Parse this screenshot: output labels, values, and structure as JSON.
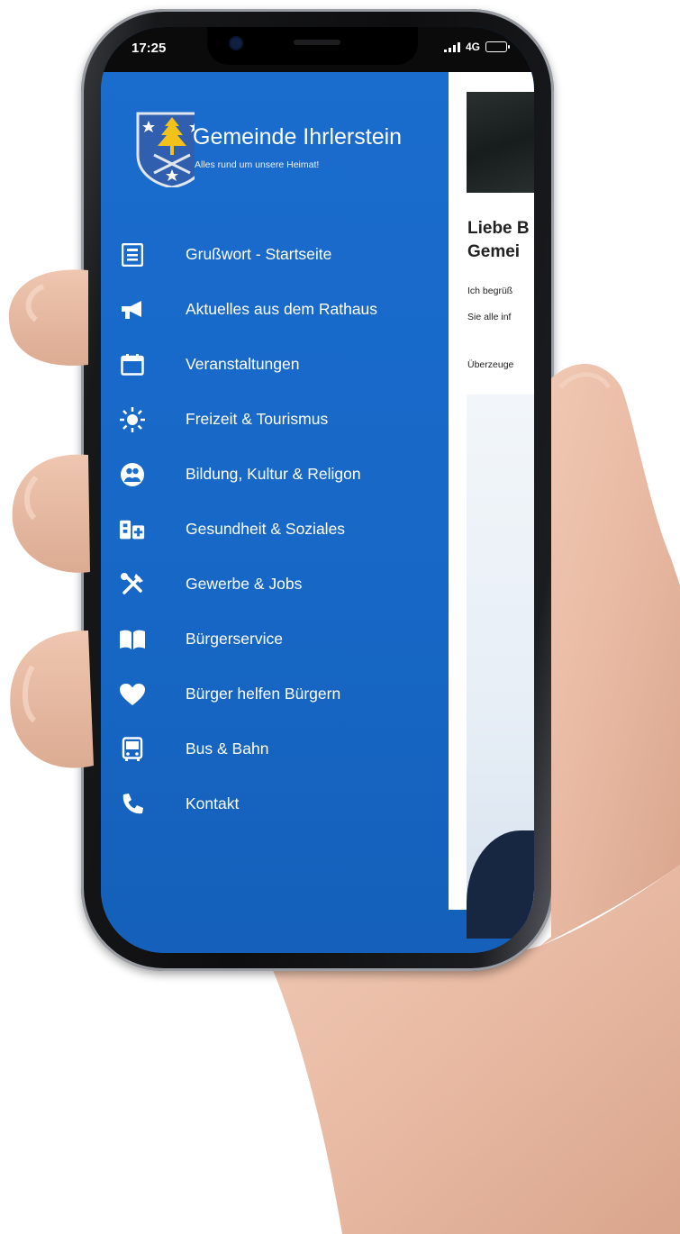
{
  "status_bar": {
    "time": "17:25",
    "network": "4G"
  },
  "header": {
    "title": "Gemeinde Ihrlerstein",
    "subtitle": "Alles rund um unsere Heimat!"
  },
  "menu": {
    "items": [
      {
        "label": "Grußwort - Startseite",
        "icon": "newspaper-icon"
      },
      {
        "label": "Aktuelles aus dem Rathaus",
        "icon": "megaphone-icon"
      },
      {
        "label": "Veranstaltungen",
        "icon": "calendar-icon"
      },
      {
        "label": "Freizeit & Tourismus",
        "icon": "sun-icon"
      },
      {
        "label": "Bildung, Kultur & Religon",
        "icon": "people-icon"
      },
      {
        "label": "Gesundheit & Soziales",
        "icon": "health-icon"
      },
      {
        "label": "Gewerbe & Jobs",
        "icon": "tools-icon"
      },
      {
        "label": "Bürgerservice",
        "icon": "book-icon"
      },
      {
        "label": "Bürger helfen Bürgern",
        "icon": "heart-icon"
      },
      {
        "label": "Bus & Bahn",
        "icon": "bus-icon"
      },
      {
        "label": "Kontakt",
        "icon": "phone-icon"
      }
    ]
  },
  "content": {
    "heading_line1": "Liebe B",
    "heading_line2": "Gemei",
    "line1": "Ich begrüß",
    "line2": "Sie alle inf",
    "line3": "Überzeuge"
  },
  "colors": {
    "primary": "#1a6ccd",
    "menu_text": "#ffffff",
    "crest_gold": "#f2c21b",
    "crest_blue": "#2f5fae"
  }
}
